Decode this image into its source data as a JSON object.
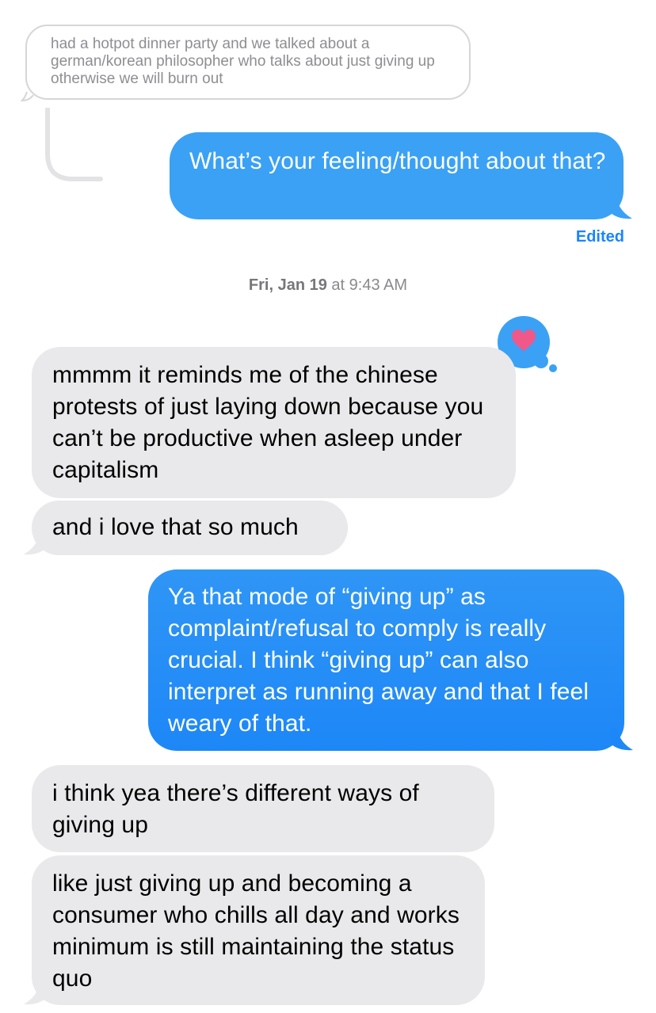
{
  "quoted_message": {
    "text": "had a hotpot dinner party and we talked about a german/korean philosopher who talks about just giving up otherwise we will burn out"
  },
  "messages": [
    {
      "direction": "sent",
      "text": "What’s your feeling/thought about that?"
    },
    {
      "direction": "received",
      "text": "mmmm it reminds me of the chinese protests of just laying down because you can’t be productive when asleep under capitalism"
    },
    {
      "direction": "received",
      "text": "and i love that so much"
    },
    {
      "direction": "sent",
      "text": "Ya that mode of “giving up” as complaint/refusal to comply is really crucial. I think “giving up” can also interpret as running away and that I feel weary of that."
    },
    {
      "direction": "received",
      "text": "i think yea there’s different ways of giving up"
    },
    {
      "direction": "received",
      "text": "like just giving up and becoming a consumer who chills all day and works minimum is still maintaining the status quo"
    }
  ],
  "edited_label": "Edited",
  "timestamp": {
    "day": "Fri, Jan 19",
    "joiner": "at",
    "time": "9:43 AM"
  },
  "tapback": {
    "icon": "heart-icon",
    "color": "#f0588a"
  },
  "colors": {
    "sent_bubble": "#3aa1f5",
    "sent_bubble_alt": "#1d87f7",
    "received_bubble": "#e9e9eb",
    "tapback_bubble": "#3aa1f5",
    "edited_text": "#1a84ff"
  }
}
